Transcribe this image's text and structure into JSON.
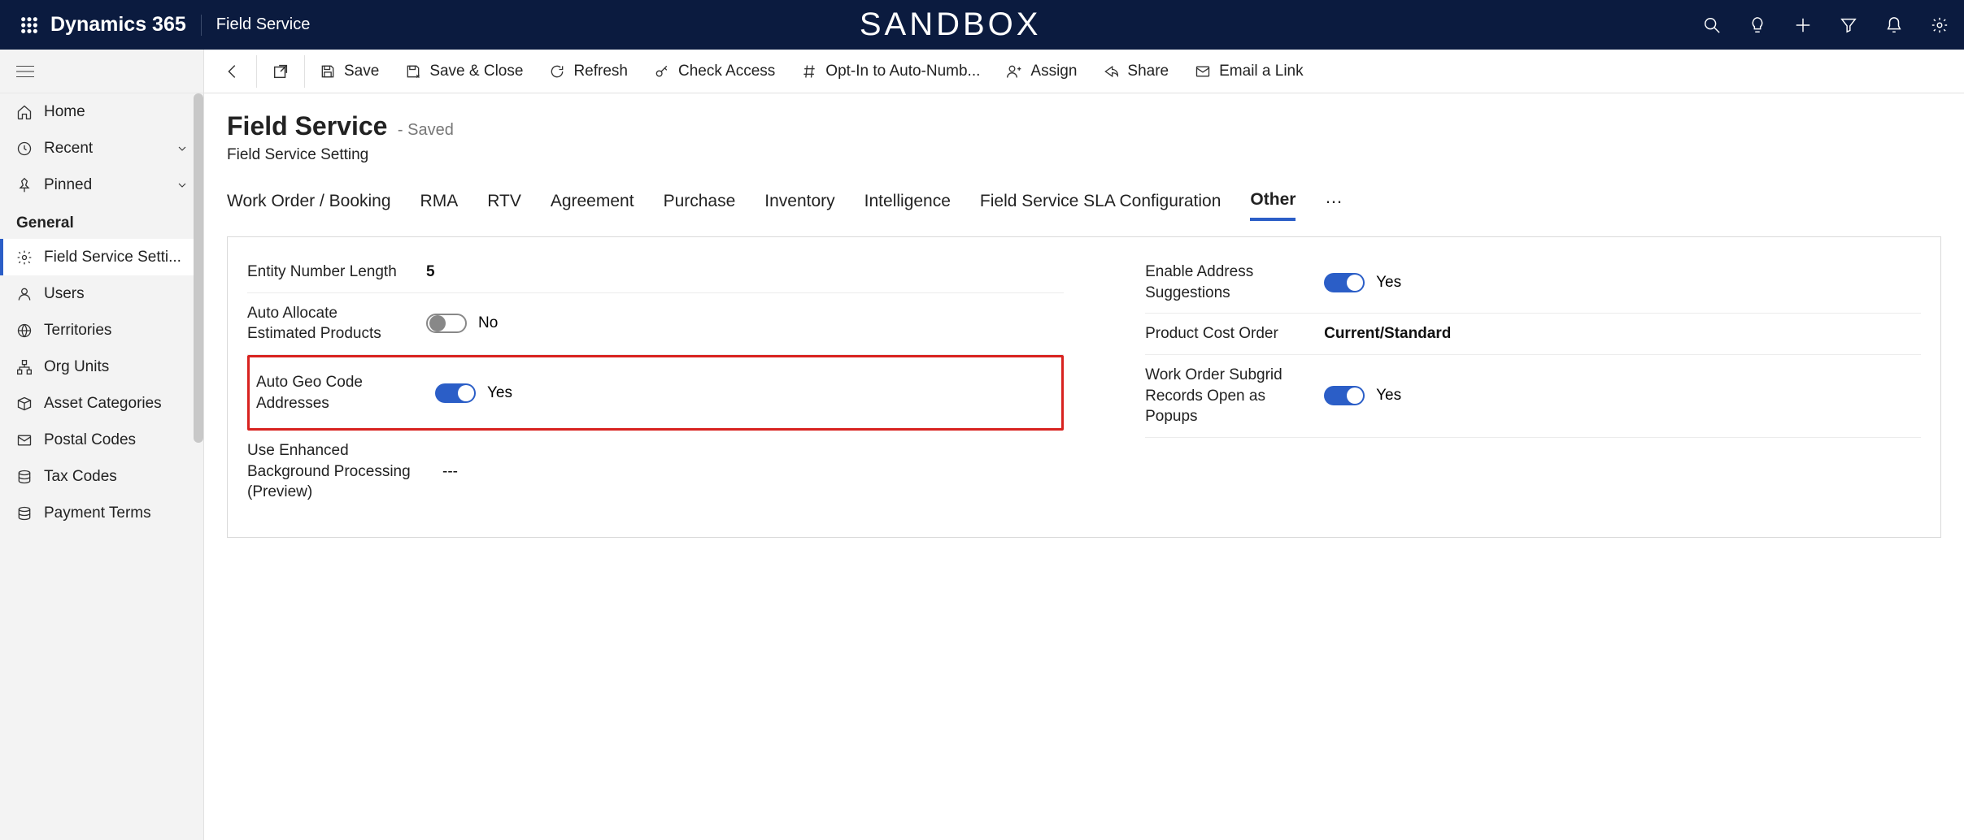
{
  "header": {
    "brand": "Dynamics 365",
    "area": "Field Service",
    "env": "SANDBOX"
  },
  "sidebar": {
    "home": "Home",
    "recent": "Recent",
    "pinned": "Pinned",
    "group": "General",
    "items": [
      "Field Service Setti...",
      "Users",
      "Territories",
      "Org Units",
      "Asset Categories",
      "Postal Codes",
      "Tax Codes",
      "Payment Terms"
    ]
  },
  "commands": {
    "save": "Save",
    "saveclose": "Save & Close",
    "refresh": "Refresh",
    "checkaccess": "Check Access",
    "autonum": "Opt-In to Auto-Numb...",
    "assign": "Assign",
    "share": "Share",
    "emaillink": "Email a Link"
  },
  "record": {
    "title": "Field Service",
    "state": "- Saved",
    "subtitle": "Field Service Setting"
  },
  "tabs": [
    "Work Order / Booking",
    "RMA",
    "RTV",
    "Agreement",
    "Purchase",
    "Inventory",
    "Intelligence",
    "Field Service SLA Configuration",
    "Other"
  ],
  "fields": {
    "entityNumLen": {
      "label": "Entity Number Length",
      "value": "5"
    },
    "autoAllocate": {
      "label": "Auto Allocate Estimated Products",
      "value": "No"
    },
    "autoGeo": {
      "label": "Auto Geo Code Addresses",
      "value": "Yes"
    },
    "enhancedBg": {
      "label": "Use Enhanced Background Processing (Preview)",
      "value": "---"
    },
    "addrSuggest": {
      "label": "Enable Address Suggestions",
      "value": "Yes"
    },
    "prodCost": {
      "label": "Product Cost Order",
      "value": "Current/Standard"
    },
    "woSubgrid": {
      "label": "Work Order Subgrid Records Open as Popups",
      "value": "Yes"
    }
  }
}
